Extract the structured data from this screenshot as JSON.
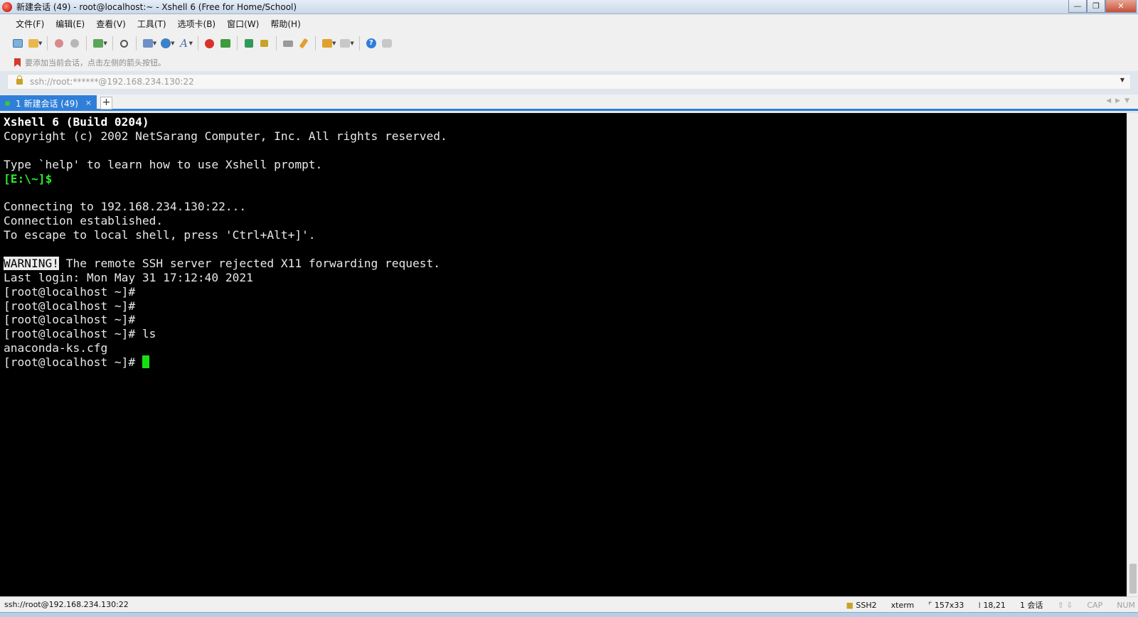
{
  "window": {
    "title": "新建会话 (49) - root@localhost:~ - Xshell 6 (Free for Home/School)",
    "minimize_glyph": "—",
    "restore_glyph": "❐",
    "close_glyph": "✕"
  },
  "menu": [
    "文件(F)",
    "编辑(E)",
    "查看(V)",
    "工具(T)",
    "选项卡(B)",
    "窗口(W)",
    "帮助(H)"
  ],
  "hint": "要添加当前会话，点击左侧的箭头按钮。",
  "address": "ssh://root:******@192.168.234.130:22",
  "tab": {
    "label": "1 新建会话 (49)",
    "close": "×",
    "add": "+"
  },
  "terminal": {
    "lines": [
      "Xshell 6 (Build 0204)",
      "Copyright (c) 2002 NetSarang Computer, Inc. All rights reserved.",
      "",
      "Type `help' to learn how to use Xshell prompt.",
      "[E:\\~]$",
      "",
      "Connecting to 192.168.234.130:22...",
      "Connection established.",
      "To escape to local shell, press 'Ctrl+Alt+]'.",
      "",
      "The remote SSH server rejected X11 forwarding request.",
      "Last login: Mon May 31 17:12:40 2021",
      "[root@localhost ~]#",
      "[root@localhost ~]#",
      "[root@localhost ~]#",
      "[root@localhost ~]# ls",
      "anaconda-ks.cfg",
      "[root@localhost ~]# "
    ],
    "warning_tag": "WARNING!"
  },
  "status": {
    "connection": "ssh://root@192.168.234.130:22",
    "protocol": "SSH2",
    "terminal_type": "xterm",
    "size": "157x33",
    "cursor_pos": "18,21",
    "sessions": "1 会话",
    "cap": "CAP",
    "num": "NUM"
  },
  "colors": {
    "tab_accent": "#2f7fd8",
    "terminal_bg": "#000000",
    "cursor": "#14e014",
    "prompt_green": "#2ee82e"
  },
  "icons": [
    "new-session-icon",
    "open-folder-icon",
    "connect-icon",
    "disconnect-icon",
    "new-window-icon",
    "find-icon",
    "properties-icon",
    "globe-icon",
    "font-icon",
    "xftp-icon",
    "xmanager-icon",
    "fullscreen-icon",
    "lock-icon",
    "keyboard-icon",
    "highlight-icon",
    "compose-icon",
    "layout-icon",
    "help-icon",
    "chat-icon"
  ]
}
